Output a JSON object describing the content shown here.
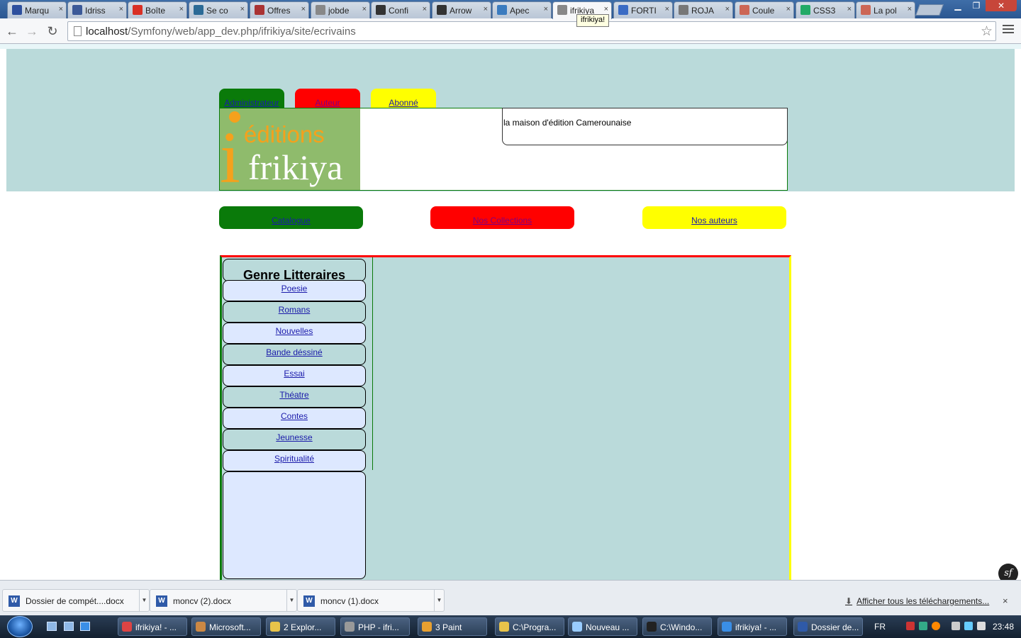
{
  "browser": {
    "tabs": [
      {
        "title": "Marqu",
        "icon": "star-icon",
        "color": "#2d4f9e"
      },
      {
        "title": "Idriss",
        "icon": "facebook-icon",
        "color": "#3b5998"
      },
      {
        "title": "Boîte",
        "icon": "gmail-icon",
        "color": "#d93025"
      },
      {
        "title": "Se co",
        "icon": "site-icon",
        "color": "#2b6a96"
      },
      {
        "title": "Offres",
        "icon": "site-icon",
        "color": "#a33"
      },
      {
        "title": "jobde",
        "icon": "site-icon",
        "color": "#888"
      },
      {
        "title": "Confi",
        "icon": "site-icon",
        "color": "#333"
      },
      {
        "title": "Arrow",
        "icon": "site-icon",
        "color": "#333"
      },
      {
        "title": "Apec",
        "icon": "site-icon",
        "color": "#3a7bbf"
      },
      {
        "title": "ifrikiya",
        "icon": "page-icon",
        "color": "#888"
      },
      {
        "title": "FORTI",
        "icon": "info-icon",
        "color": "#3a6bc4"
      },
      {
        "title": "ROJA",
        "icon": "site-icon",
        "color": "#777"
      },
      {
        "title": "Coule",
        "icon": "site-icon",
        "color": "#c65"
      },
      {
        "title": "CSS3",
        "icon": "site-icon",
        "color": "#2a6"
      },
      {
        "title": "La pol",
        "icon": "site-icon",
        "color": "#c65"
      }
    ],
    "tab_close": "×",
    "tooltip": "ifrikiya!",
    "url_host": "localhost",
    "url_path": "/Symfony/web/app_dev.php/ifrikiya/site/ecrivains"
  },
  "page": {
    "roles": [
      {
        "label": "Administrateur",
        "bg": "#0a7a0a",
        "link": "#1a1aaa"
      },
      {
        "label": "Auteur",
        "bg": "#ff0000",
        "link": "#800080"
      },
      {
        "label": "Abonné",
        "bg": "#ffff00",
        "link": "#1a1aaa"
      }
    ],
    "logo": {
      "i": "i",
      "editions": "éditions",
      "frikiya": "frikiya"
    },
    "tagline": "la maison d'édition Camerounaise",
    "nav": [
      {
        "label": "Catalogue",
        "bg": "#0a7a0a",
        "link": "#1a1aaa"
      },
      {
        "label": "Nos Collections",
        "bg": "#ff0000",
        "link": "#800080"
      },
      {
        "label": "Nos auteurs",
        "bg": "#ffff00",
        "link": "#1a1aaa"
      }
    ],
    "genre_title": "Genre Litteraires",
    "genres": [
      "Poesie",
      "Romans",
      "Nouvelles",
      "Bande déssiné",
      "Essai",
      "Théatre",
      "Contes",
      "Jeunesse",
      "Spiritualité"
    ],
    "genre_bg_odd": "#dde8ff",
    "genre_bg_even": "#badada",
    "symfony_badge": "sf"
  },
  "downloads": {
    "items": [
      "Dossier de compét....docx",
      "moncv (2).docx",
      "moncv (1).docx"
    ],
    "show_all": "Afficher tous les téléchargements...",
    "close": "×"
  },
  "taskbar": {
    "items": [
      {
        "label": "ifrikiya! - ...",
        "color": "#d44"
      },
      {
        "label": "Microsoft...",
        "color": "#c84"
      },
      {
        "label": "2 Explor...",
        "color": "#e8c34a"
      },
      {
        "label": "PHP - ifri...",
        "color": "#999"
      },
      {
        "label": "3 Paint",
        "color": "#e8a030"
      },
      {
        "label": "C:\\Progra...",
        "color": "#e8c34a"
      },
      {
        "label": "Nouveau ...",
        "color": "#9cf"
      },
      {
        "label": "C:\\Windo...",
        "color": "#222"
      },
      {
        "label": "ifrikiya! - ...",
        "color": "#3a8ee6"
      },
      {
        "label": "Dossier de...",
        "color": "#2f5aa8"
      }
    ],
    "lang": "FR",
    "clock": "23:48"
  }
}
